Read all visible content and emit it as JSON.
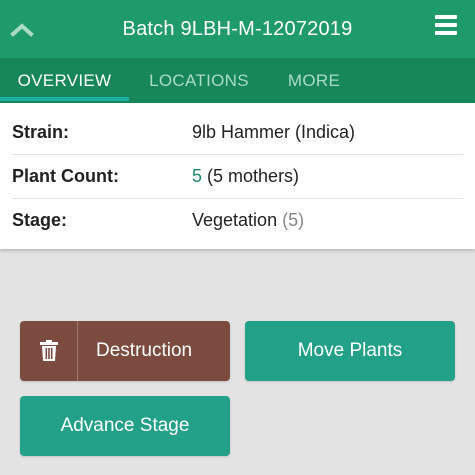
{
  "header": {
    "title": "Batch 9LBH-M-12072019",
    "up_icon": "chevron-up-icon",
    "menu_icon": "hamburger-menu-icon",
    "color": "#1e9a6b"
  },
  "tabs": [
    {
      "label": "OVERVIEW",
      "active": true
    },
    {
      "label": "LOCATIONS",
      "active": false
    },
    {
      "label": "MORE",
      "active": false
    }
  ],
  "details": {
    "strain": {
      "label": "Strain:",
      "value": "9lb Hammer (Indica)"
    },
    "plant_count": {
      "label": "Plant Count:",
      "count": "5",
      "note": "(5 mothers)"
    },
    "stage": {
      "label": "Stage:",
      "value": "Vegetation",
      "count": "(5)"
    }
  },
  "actions": {
    "destruction": {
      "label": "Destruction",
      "icon": "trash-icon",
      "color": "#7b4b3f"
    },
    "move_plants": {
      "label": "Move Plants",
      "color": "#22a088"
    },
    "advance_stage": {
      "label": "Advance Stage",
      "color": "#22a088"
    }
  }
}
